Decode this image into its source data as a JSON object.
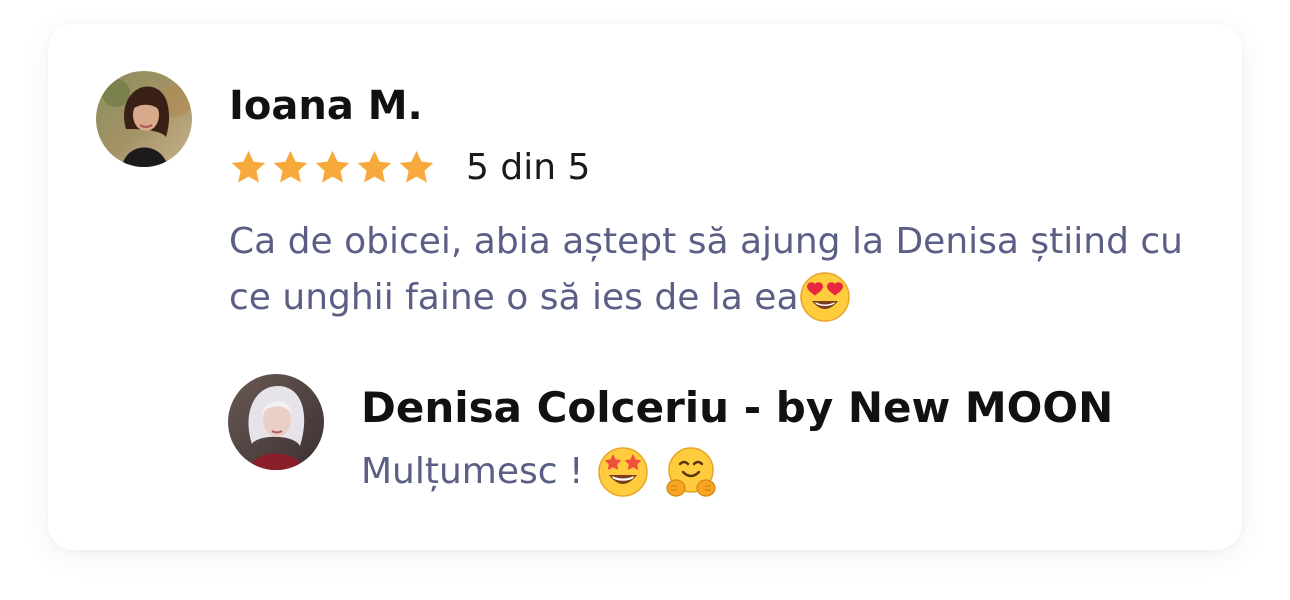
{
  "review": {
    "author": "Ioana M.",
    "rating": 5,
    "rating_max": 5,
    "rating_text": "5 din 5",
    "star_color": "#F7A93B",
    "text": "Ca de obicei, abia aștept să ajung la Denisa știind cu ce unghii faine o să ies de la ea",
    "emoji": "heart-eyes-face-icon"
  },
  "reply": {
    "author": "Denisa Colceriu - by New MOON",
    "text": "Mulțumesc !",
    "emojis": [
      "star-struck-face-icon",
      "hugging-face-icon"
    ]
  },
  "colors": {
    "name": "#111111",
    "body_text": "#5b5f85",
    "card_background": "#ffffff"
  }
}
